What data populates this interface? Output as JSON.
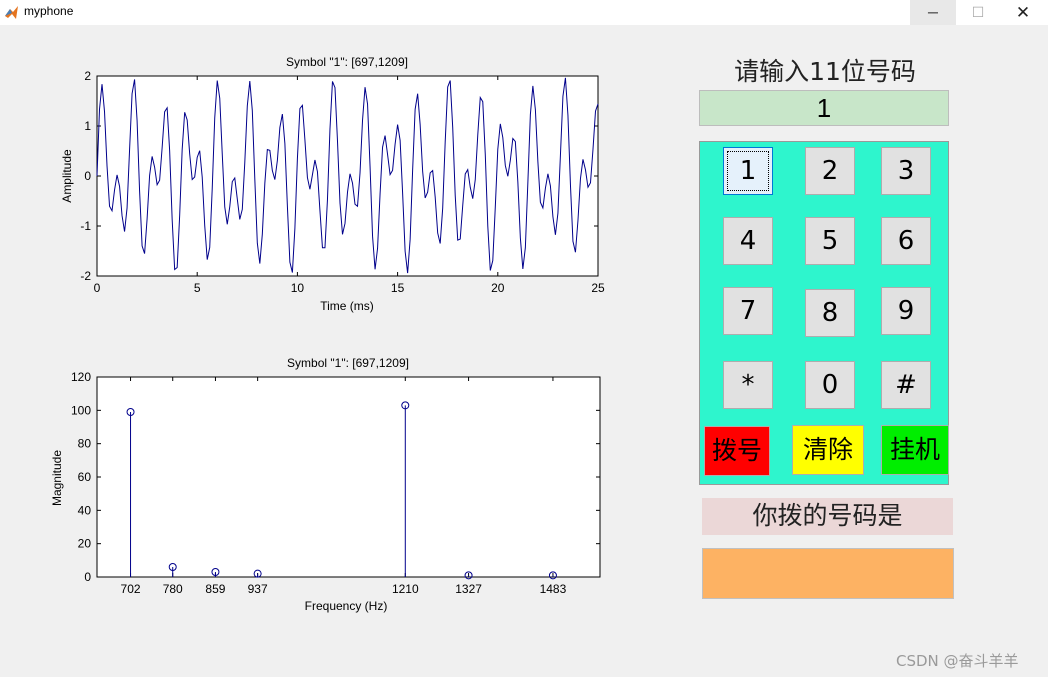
{
  "window": {
    "title": "myphone",
    "minimize_glyph": "─",
    "maximize_glyph": "☐",
    "close_glyph": "✕"
  },
  "prompt_label": "请输入11位号码",
  "number_display": "1",
  "keypad": {
    "keys": [
      "1",
      "2",
      "3",
      "4",
      "5",
      "6",
      "7",
      "8",
      "9",
      "*",
      "0",
      "#"
    ],
    "dial_label": "拨号",
    "clear_label": "清除",
    "hangup_label": "挂机",
    "colors": {
      "background": "#2ef5cd",
      "dial": "#ff0000",
      "clear": "#ffff00",
      "hangup": "#00ee00"
    }
  },
  "dialed_label": "你拨的号码是",
  "dialed_value": "",
  "watermark": "CSDN @奋斗羊羊",
  "chart_data": [
    {
      "type": "line",
      "title": "Symbol \"1\": [697,1209]",
      "xlabel": "Time (ms)",
      "ylabel": "Amplitude",
      "xlim": [
        0,
        25
      ],
      "ylim": [
        -2,
        2
      ],
      "xticks": [
        "0",
        "5",
        "10",
        "15",
        "20",
        "25"
      ],
      "yticks": [
        "-2",
        "-1",
        "0",
        "1",
        "2"
      ],
      "series": [
        {
          "frequencies_hz": [
            697,
            1209
          ],
          "color": "#00008b"
        }
      ]
    },
    {
      "type": "stem",
      "title": "Symbol \"1\": [697,1209]",
      "xlabel": "Frequency (Hz)",
      "ylabel": "Magnitude",
      "ylim": [
        0,
        120
      ],
      "yticks": [
        "0",
        "20",
        "40",
        "60",
        "80",
        "100",
        "120"
      ],
      "categories": [
        "702",
        "780",
        "859",
        "937",
        "1210",
        "1327",
        "1483"
      ],
      "values": [
        99,
        6,
        3,
        2,
        103,
        1,
        1
      ],
      "color": "#00008b"
    }
  ]
}
